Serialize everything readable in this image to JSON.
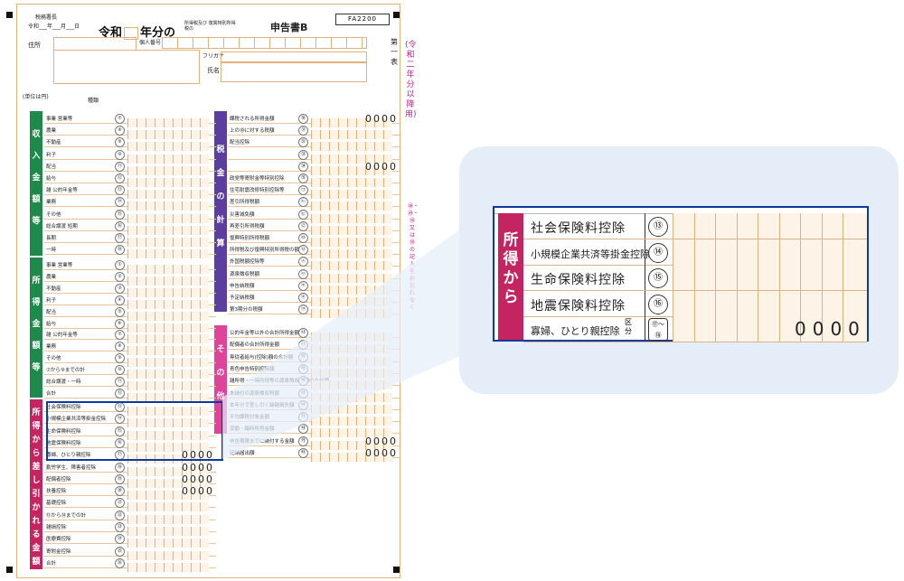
{
  "form": {
    "code": "FA2200",
    "title_prefix": "令和",
    "title_suffix": "年分の",
    "title_small": "所得税及び 復興特別所得税の",
    "title_main": "申告書B",
    "office_label": "税務署長",
    "date_label": "令和___年___月___日",
    "address_label": "住所",
    "mynumber_label": "個人番号",
    "furigana_label": "フリガナ",
    "name_label": "氏名",
    "table_label": "第一表",
    "side_note": "(令和二年分以降用)",
    "side_warning": "㊽・㊾・㊿又は㊿の記入をお忘れなく",
    "unit_label": "(単位は円)",
    "kind_label": "種類"
  },
  "income_section": {
    "label": "収入金額等",
    "rows": [
      "事業 営業等",
      "農業",
      "不動産",
      "利子",
      "配当",
      "給与",
      "雑 公的年金等",
      "業務",
      "その他",
      "総合譲渡 短期",
      "長期",
      "一時"
    ]
  },
  "shotoku_section": {
    "label": "所得金額等",
    "rows": [
      "事業 営業等",
      "農業",
      "不動産",
      "利子",
      "配当",
      "給与",
      "雑 公的年金等",
      "業務",
      "その他",
      "⑦から⑨までの計",
      "総合譲渡・一時",
      "合計"
    ]
  },
  "deduction_section": {
    "label": "所得から差し引かれる金額",
    "rows": [
      "社会保険料控除",
      "小規模企業共済等掛金控除",
      "生命保険料控除",
      "地震保険料控除",
      "寡婦、ひとり親控除",
      "勤労学生、障害者控除",
      "配偶者控除",
      "扶養控除",
      "基礎控除",
      "⑬から㉔までの計",
      "雑損控除",
      "医療費控除",
      "寄附金控除",
      "合計"
    ]
  },
  "tax_section": {
    "label": "税金の計算",
    "rows": [
      "課税される所得金額",
      "上の㉚に対する税額",
      "配当控除",
      "",
      "",
      "政党等寄附金等特別控除",
      "住宅耐震改修特別控除等",
      "差引所得税額",
      "災害減免額",
      "再差引所得税額",
      "復興特別所得税額",
      "所得税及び復興特別所得税の額",
      "外国税額控除等",
      "源泉徴収税額",
      "申告納税額",
      "予定納税額",
      "第3期分の税額"
    ]
  },
  "other_section": {
    "label": "その他",
    "rows": [
      "公的年金等以外の合計所得金額",
      "配偶者の合計所得金額",
      "専従者給与(控除)額の合計額",
      "青色申告特別控除額",
      "雑所得・一時所得等の源泉徴収税額の合計額",
      "未納付の源泉徴収税額",
      "本年分で差し引く繰越損失額",
      "平均課税対象金額",
      "変動・臨時所得金額",
      "申告期限までに納付する金額",
      "延納届出額"
    ]
  },
  "zoom": {
    "section_label": "所得から",
    "rows": [
      {
        "label": "社会保険料控除",
        "num": "⑬",
        "value": ""
      },
      {
        "label": "小規模企業共済等掛金控除",
        "num": "⑭",
        "value": ""
      },
      {
        "label": "生命保険料控除",
        "num": "⑮",
        "value": ""
      },
      {
        "label": "地震保険料控除",
        "num": "⑯",
        "value": ""
      },
      {
        "label": "寡婦、ひとり親控除",
        "num": "⑰〜⑱",
        "value": "0000"
      }
    ],
    "kubun_label": "区分"
  },
  "colors": {
    "income_green": "#1e8a4a",
    "tax_purple": "#5a3ea0",
    "deduction_magenta": "#c4245f",
    "other_pink": "#e0449a",
    "highlight_blue": "#0d3a9e"
  }
}
